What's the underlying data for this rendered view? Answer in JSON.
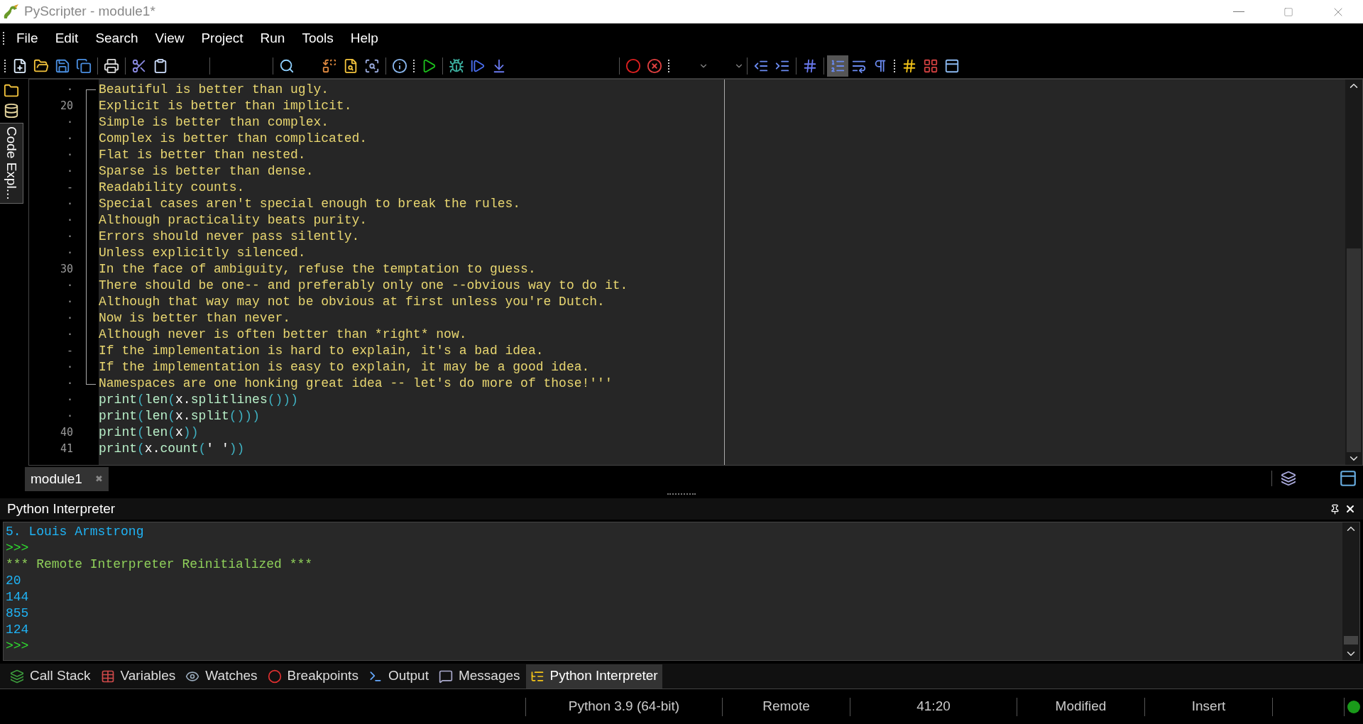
{
  "window": {
    "title": "PyScripter - module1*"
  },
  "menu": [
    "File",
    "Edit",
    "Search",
    "View",
    "Project",
    "Run",
    "Tools",
    "Help"
  ],
  "toolbar": {
    "line_numbers_toggle": {
      "on": true
    }
  },
  "side_tab": {
    "label": "Code Expl..."
  },
  "editor": {
    "lines": [
      {
        "gutter": "·",
        "kind": "string",
        "text": "Beautiful is better than ugly."
      },
      {
        "gutter": "20",
        "kind": "string",
        "text": "Explicit is better than implicit."
      },
      {
        "gutter": "·",
        "kind": "string",
        "text": "Simple is better than complex."
      },
      {
        "gutter": "·",
        "kind": "string",
        "text": "Complex is better than complicated."
      },
      {
        "gutter": "·",
        "kind": "string",
        "text": "Flat is better than nested."
      },
      {
        "gutter": "·",
        "kind": "string",
        "text": "Sparse is better than dense."
      },
      {
        "gutter": "-",
        "kind": "string",
        "text": "Readability counts."
      },
      {
        "gutter": "·",
        "kind": "string",
        "text": "Special cases aren't special enough to break the rules."
      },
      {
        "gutter": "·",
        "kind": "string",
        "text": "Although practicality beats purity."
      },
      {
        "gutter": "·",
        "kind": "string",
        "text": "Errors should never pass silently."
      },
      {
        "gutter": "·",
        "kind": "string",
        "text": "Unless explicitly silenced."
      },
      {
        "gutter": "30",
        "kind": "string",
        "text": "In the face of ambiguity, refuse the temptation to guess."
      },
      {
        "gutter": "·",
        "kind": "string",
        "text": "There should be one-- and preferably only one --obvious way to do it."
      },
      {
        "gutter": "·",
        "kind": "string",
        "text": "Although that way may not be obvious at first unless you're Dutch."
      },
      {
        "gutter": "·",
        "kind": "string",
        "text": "Now is better than never."
      },
      {
        "gutter": "·",
        "kind": "string",
        "text": "Although never is often better than *right* now."
      },
      {
        "gutter": "-",
        "kind": "string",
        "text": "If the implementation is hard to explain, it's a bad idea."
      },
      {
        "gutter": "·",
        "kind": "string",
        "text": "If the implementation is easy to explain, it may be a good idea."
      },
      {
        "gutter": "·",
        "kind": "string",
        "text": "Namespaces are one honking great idea -- let's do more of those!'''"
      },
      {
        "gutter": "·",
        "kind": "code",
        "text": "print(len(x.splitlines()))"
      },
      {
        "gutter": "·",
        "kind": "code",
        "text": "print(len(x.split()))"
      },
      {
        "gutter": "40",
        "kind": "code",
        "text": "print(len(x))"
      },
      {
        "gutter": "41",
        "kind": "code",
        "text": "print(x.count(' '))"
      }
    ]
  },
  "editor_tabs": [
    {
      "label": "module1",
      "close": "✖",
      "selected": true
    }
  ],
  "interpreter": {
    "title": "Python Interpreter",
    "lines": [
      {
        "kind": "output",
        "text": "5. Louis Armstrong"
      },
      {
        "kind": "prompt",
        "text": ">>>"
      },
      {
        "kind": "message",
        "text": "*** Remote Interpreter Reinitialized ***"
      },
      {
        "kind": "output",
        "text": "20"
      },
      {
        "kind": "output",
        "text": "144"
      },
      {
        "kind": "output",
        "text": "855"
      },
      {
        "kind": "output",
        "text": "124"
      },
      {
        "kind": "prompt",
        "text": ">>>"
      }
    ]
  },
  "bottom_tabs": [
    {
      "label": "Call Stack",
      "selected": false
    },
    {
      "label": "Variables",
      "selected": false
    },
    {
      "label": "Watches",
      "selected": false
    },
    {
      "label": "Breakpoints",
      "selected": false
    },
    {
      "label": "Output",
      "selected": false
    },
    {
      "label": "Messages",
      "selected": false
    },
    {
      "label": "Python Interpreter",
      "selected": true
    }
  ],
  "status_bar": [
    "Python 3.9 (64-bit)",
    "Remote",
    "41:20",
    "Modified",
    "Insert"
  ]
}
